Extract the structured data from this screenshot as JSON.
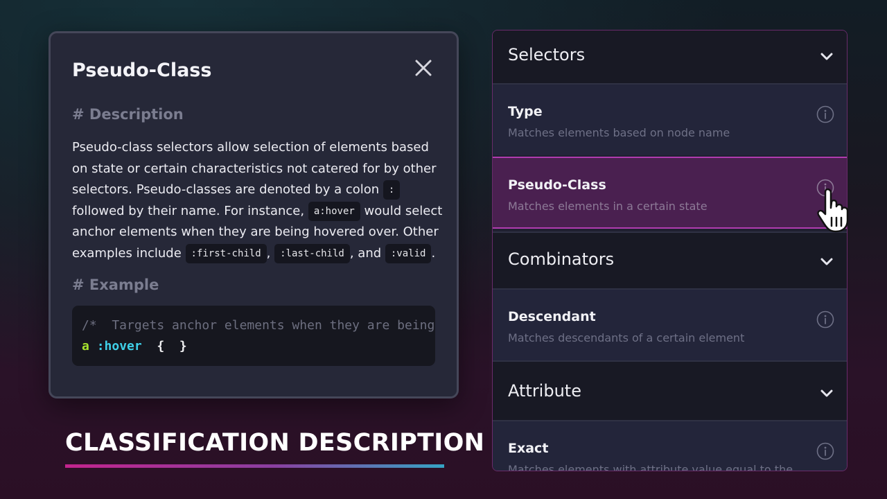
{
  "modal": {
    "title": "Pseudo-Class",
    "description_heading": "# Description",
    "description": {
      "t1": "Pseudo-class selectors allow selection of elements based on state or certain characteristics not catered for by other selectors. Pseudo-classes are denoted by a colon ",
      "c1": ":",
      "t2": " followed by their name. For instance, ",
      "c2": "a:hover",
      "t3": " would select anchor elements when they are being hovered over. Other examples include ",
      "c3": ":first-child",
      "t4": ", ",
      "c4": ":last-child",
      "t5": ", and ",
      "c5": ":valid",
      "t6": "."
    },
    "example_heading": "# Example",
    "code": {
      "comment": "/*  Targets anchor elements when they are being hovered over  */",
      "sel_a": "a",
      "sel_pseudo": ":hover",
      "braces": "{  }"
    }
  },
  "caption": "CLASSIFICATION DESCRIPTION",
  "panel": {
    "groups": [
      {
        "label": "Selectors"
      },
      {
        "label": "Combinators"
      },
      {
        "label": "Attribute"
      }
    ],
    "items": [
      {
        "name": "Type",
        "sub": "Matches elements based on node name"
      },
      {
        "name": "Pseudo-Class",
        "sub": "Matches elements in a certain state"
      },
      {
        "name": "Descendant",
        "sub": "Matches descendants of a certain element"
      },
      {
        "name": "Exact",
        "sub": "Matches elements with attribute value equal to the"
      }
    ]
  },
  "colors": {
    "accent": "#b03cb0",
    "active_bg": "#4a2050",
    "code_green": "#a6e22e",
    "code_cyan": "#3fd0e8"
  }
}
